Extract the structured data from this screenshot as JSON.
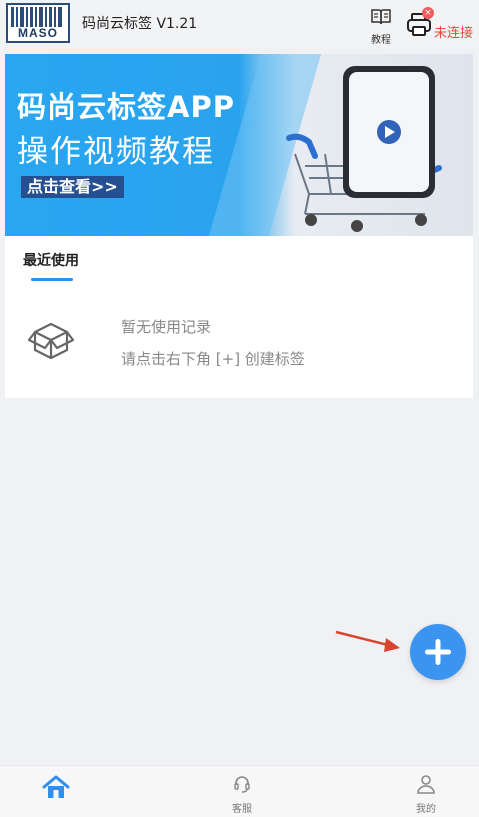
{
  "header": {
    "logo_text": "MASO",
    "title": "码尚云标签 V1.21",
    "tutorial_label": "教程",
    "connection_status": "未连接",
    "printer_badge": "×"
  },
  "banner": {
    "title_line1": "码尚云标签APP",
    "title_line2": "操作视频教程",
    "cta": "点击查看>>"
  },
  "recent": {
    "tab_label": "最近使用",
    "empty_line1": "暂无使用记录",
    "empty_line2": "请点击右下角 [+] 创建标签"
  },
  "nav": {
    "home_label": "",
    "service_label": "客服",
    "mine_label": "我的"
  },
  "colors": {
    "accent": "#3b95f0",
    "banner_blue": "#28a6f0",
    "status_red": "#e84a3c"
  },
  "icons": [
    "book-icon",
    "printer-icon",
    "play-icon",
    "empty-box-icon",
    "plus-icon",
    "home-icon",
    "headset-icon",
    "user-icon",
    "arrow-icon"
  ]
}
